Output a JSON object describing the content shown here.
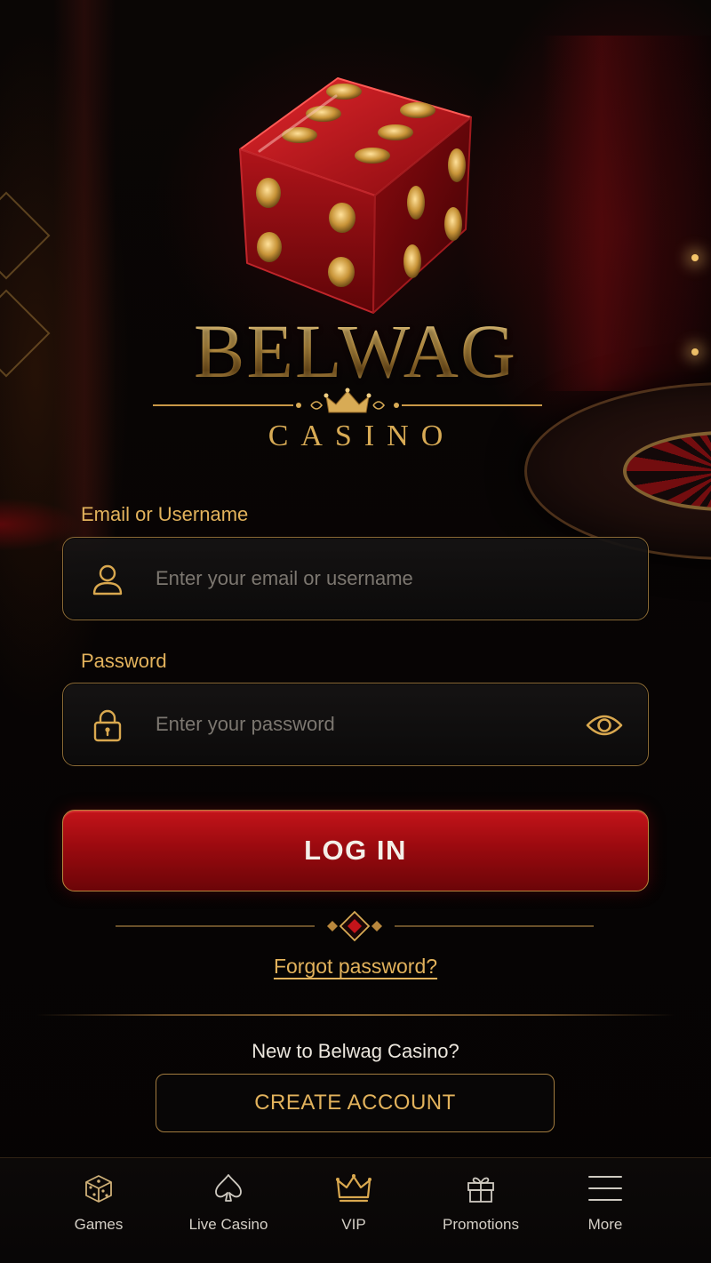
{
  "brand": {
    "name": "BELWAG",
    "subtitle": "CASINO"
  },
  "form": {
    "email_label": "Email or Username",
    "email_placeholder": "Enter your email or username",
    "password_label": "Password",
    "password_placeholder": "Enter your password",
    "login_button": "LOG IN",
    "forgot_link": "Forgot password?"
  },
  "signup": {
    "prompt": "New to Belwag Casino?",
    "button": "CREATE ACCOUNT"
  },
  "nav": {
    "items": [
      {
        "label": "Games",
        "icon": "dice-icon"
      },
      {
        "label": "Live Casino",
        "icon": "spade-icon"
      },
      {
        "label": "VIP",
        "icon": "crown-icon"
      },
      {
        "label": "Promotions",
        "icon": "gift-icon"
      },
      {
        "label": "More",
        "icon": "menu-icon"
      }
    ]
  },
  "colors": {
    "gold": "#e2b25c",
    "red": "#b30f14",
    "background": "#060404"
  }
}
